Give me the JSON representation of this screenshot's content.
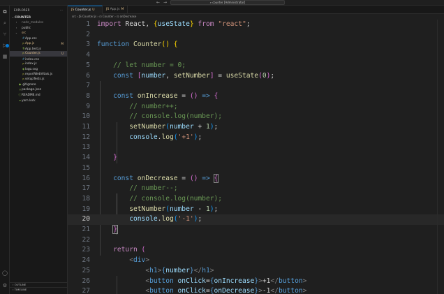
{
  "titlebar": {
    "back": "←",
    "forward": "→",
    "search_icon": "⌕",
    "command_center": "counter [Administrator]"
  },
  "activity": {
    "icons": [
      "⧉",
      "⌕",
      "⑂",
      "▷",
      "▦"
    ],
    "bottom_icons": [
      "◯",
      "⚙"
    ]
  },
  "sidebar": {
    "title": "EXPLORER",
    "more": "···",
    "root": "COUNTER",
    "items": [
      {
        "label": "node_modules",
        "twisty": "›",
        "icon": "",
        "indent": 1,
        "gold": false,
        "dim": true
      },
      {
        "label": "public",
        "twisty": "›",
        "icon": "",
        "indent": 1,
        "gold": false,
        "dim": false
      },
      {
        "label": "src",
        "twisty": "⌄",
        "icon": "",
        "indent": 1,
        "gold": true,
        "badge": "",
        "dim": false
      },
      {
        "label": "App.css",
        "twisty": "",
        "icon": "#",
        "indent": 2,
        "gold": false,
        "dim": false
      },
      {
        "label": "App.js",
        "twisty": "",
        "icon": "JS",
        "indent": 2,
        "gold": true,
        "badge": "M",
        "dim": false
      },
      {
        "label": "App.test.js",
        "twisty": "",
        "icon": "⚗",
        "indent": 2,
        "gold": false,
        "dim": false
      },
      {
        "label": "Counter.js",
        "twisty": "",
        "icon": "JS",
        "indent": 2,
        "gold": true,
        "badge": "U",
        "selected": true,
        "dim": false
      },
      {
        "label": "index.css",
        "twisty": "",
        "icon": "#",
        "indent": 2,
        "gold": false,
        "dim": false
      },
      {
        "label": "index.js",
        "twisty": "",
        "icon": "JS",
        "indent": 2,
        "gold": false,
        "dim": false
      },
      {
        "label": "logo.svg",
        "twisty": "",
        "icon": "◈",
        "indent": 2,
        "gold": false,
        "dim": false
      },
      {
        "label": "reportWebVitals.js",
        "twisty": "",
        "icon": "JS",
        "indent": 2,
        "gold": false,
        "dim": false
      },
      {
        "label": "setupTests.js",
        "twisty": "",
        "icon": "JS",
        "indent": 2,
        "gold": false,
        "dim": false
      },
      {
        "label": ".gitignore",
        "twisty": "",
        "icon": "◆",
        "indent": 1,
        "gold": false,
        "dim": false
      },
      {
        "label": "package.json",
        "twisty": "",
        "icon": "{}",
        "indent": 1,
        "gold": false,
        "dim": false
      },
      {
        "label": "README.md",
        "twisty": "",
        "icon": "ⓘ",
        "indent": 1,
        "gold": false,
        "dim": false
      },
      {
        "label": "yarn.lock",
        "twisty": "",
        "icon": "≡",
        "indent": 1,
        "gold": false,
        "dim": false
      }
    ],
    "outline": "OUTLINE",
    "timeline": "TIMELINE"
  },
  "tabs": [
    {
      "icon": "JS",
      "label": "Counter.js",
      "badge": "U",
      "active": true
    },
    {
      "icon": "JS",
      "label": "App.js",
      "badge": "M",
      "active": false
    }
  ],
  "breadcrumb": "src › JS Counter.js › ⊡ Counter › ⊡ onDecrease",
  "editor": {
    "current_line": 20,
    "lines": [
      {
        "n": "1",
        "t": [
          [
            "k",
            "import "
          ],
          [
            "p",
            "React, "
          ],
          [
            "y",
            "{"
          ],
          [
            "v",
            "useState"
          ],
          [
            "y",
            "}"
          ],
          [
            "k",
            " from "
          ],
          [
            "s",
            "\"react\""
          ],
          [
            "p",
            ";"
          ]
        ]
      },
      {
        "n": "2",
        "t": []
      },
      {
        "n": "3",
        "t": [
          [
            "b",
            "function "
          ],
          [
            "f",
            "Counter"
          ],
          [
            "y",
            "()"
          ],
          [
            "p",
            " "
          ],
          [
            "y",
            "{"
          ]
        ]
      },
      {
        "n": "4",
        "t": []
      },
      {
        "n": "5",
        "t": [
          [
            "p",
            "    "
          ],
          [
            "c",
            "// let number = 0;"
          ]
        ]
      },
      {
        "n": "6",
        "t": [
          [
            "p",
            "    "
          ],
          [
            "b",
            "const "
          ],
          [
            "m",
            "["
          ],
          [
            "v",
            "number"
          ],
          [
            "p",
            ", "
          ],
          [
            "f",
            "setNumber"
          ],
          [
            "m",
            "]"
          ],
          [
            "p",
            " = "
          ],
          [
            "f",
            "useState"
          ],
          [
            "m",
            "("
          ],
          [
            "n",
            "0"
          ],
          [
            "m",
            ")"
          ],
          [
            "p",
            ";"
          ]
        ]
      },
      {
        "n": "7",
        "t": []
      },
      {
        "n": "8",
        "t": [
          [
            "p",
            "    "
          ],
          [
            "b",
            "const "
          ],
          [
            "f",
            "onIncrease"
          ],
          [
            "p",
            " = "
          ],
          [
            "m",
            "()"
          ],
          [
            "b",
            " => "
          ],
          [
            "m",
            "{"
          ]
        ]
      },
      {
        "n": "9",
        "t": [
          [
            "p",
            "        "
          ],
          [
            "c",
            "// number++;"
          ]
        ]
      },
      {
        "n": "10",
        "t": [
          [
            "p",
            "        "
          ],
          [
            "c",
            "// console.log(number);"
          ]
        ]
      },
      {
        "n": "11",
        "t": [
          [
            "p",
            "        "
          ],
          [
            "f",
            "setNumber"
          ],
          [
            "bl",
            "("
          ],
          [
            "v",
            "number"
          ],
          [
            "p",
            " + "
          ],
          [
            "n",
            "1"
          ],
          [
            "bl",
            ")"
          ],
          [
            "p",
            ";"
          ]
        ]
      },
      {
        "n": "12",
        "t": [
          [
            "p",
            "        "
          ],
          [
            "v",
            "console"
          ],
          [
            "p",
            "."
          ],
          [
            "f",
            "log"
          ],
          [
            "bl",
            "("
          ],
          [
            "s",
            "'+1'"
          ],
          [
            "bl",
            ")"
          ],
          [
            "p",
            ";"
          ]
        ]
      },
      {
        "n": "13",
        "t": []
      },
      {
        "n": "14",
        "t": [
          [
            "p",
            "    "
          ],
          [
            "m",
            "}"
          ]
        ]
      },
      {
        "n": "15",
        "t": []
      },
      {
        "n": "16",
        "t": [
          [
            "p",
            "    "
          ],
          [
            "b",
            "const "
          ],
          [
            "f",
            "onDecrease"
          ],
          [
            "p",
            " = "
          ],
          [
            "m",
            "()"
          ],
          [
            "b",
            " => "
          ],
          [
            "mb",
            "{"
          ]
        ]
      },
      {
        "n": "17",
        "t": [
          [
            "p",
            "        "
          ],
          [
            "c",
            "// number--;"
          ]
        ]
      },
      {
        "n": "18",
        "t": [
          [
            "p",
            "        "
          ],
          [
            "c",
            "// console.log(number);"
          ]
        ]
      },
      {
        "n": "19",
        "t": [
          [
            "p",
            "        "
          ],
          [
            "f",
            "setNumber"
          ],
          [
            "bl",
            "("
          ],
          [
            "v",
            "number"
          ],
          [
            "p",
            " - "
          ],
          [
            "n",
            "1"
          ],
          [
            "bl",
            ")"
          ],
          [
            "p",
            ";"
          ]
        ]
      },
      {
        "n": "20",
        "t": [
          [
            "p",
            "        "
          ],
          [
            "v",
            "console"
          ],
          [
            "p",
            "."
          ],
          [
            "f",
            "log"
          ],
          [
            "bl",
            "("
          ],
          [
            "s",
            "'-1'"
          ],
          [
            "bl",
            ")"
          ],
          [
            "p",
            ";"
          ]
        ]
      },
      {
        "n": "21",
        "t": [
          [
            "p",
            "    "
          ],
          [
            "mb",
            "}"
          ]
        ]
      },
      {
        "n": "22",
        "t": []
      },
      {
        "n": "23",
        "t": [
          [
            "p",
            "    "
          ],
          [
            "k",
            "return "
          ],
          [
            "m",
            "("
          ]
        ]
      },
      {
        "n": "24",
        "t": [
          [
            "p",
            "        "
          ],
          [
            "tg",
            "<"
          ],
          [
            "b",
            "div"
          ],
          [
            "tg",
            ">"
          ]
        ]
      },
      {
        "n": "25",
        "t": [
          [
            "p",
            "            "
          ],
          [
            "tg",
            "<"
          ],
          [
            "b",
            "h1"
          ],
          [
            "tg",
            ">"
          ],
          [
            "b",
            "{"
          ],
          [
            "v",
            "number"
          ],
          [
            "b",
            "}"
          ],
          [
            "tg",
            "</"
          ],
          [
            "b",
            "h1"
          ],
          [
            "tg",
            ">"
          ]
        ]
      },
      {
        "n": "26",
        "t": [
          [
            "p",
            "            "
          ],
          [
            "tg",
            "<"
          ],
          [
            "b",
            "button "
          ],
          [
            "v",
            "onClick"
          ],
          [
            "p",
            "="
          ],
          [
            "b",
            "{"
          ],
          [
            "v",
            "onIncrease"
          ],
          [
            "b",
            "}"
          ],
          [
            "tg",
            ">"
          ],
          [
            "p",
            "+1"
          ],
          [
            "tg",
            "</"
          ],
          [
            "b",
            "button"
          ],
          [
            "tg",
            ">"
          ]
        ]
      },
      {
        "n": "27",
        "t": [
          [
            "p",
            "            "
          ],
          [
            "tg",
            "<"
          ],
          [
            "b",
            "button "
          ],
          [
            "v",
            "onClick"
          ],
          [
            "p",
            "="
          ],
          [
            "b",
            "{"
          ],
          [
            "v",
            "onDecrease"
          ],
          [
            "b",
            "}"
          ],
          [
            "tg",
            ">"
          ],
          [
            "p",
            "-1"
          ],
          [
            "tg",
            "</"
          ],
          [
            "b",
            "button"
          ],
          [
            "tg",
            ">"
          ]
        ]
      }
    ]
  }
}
